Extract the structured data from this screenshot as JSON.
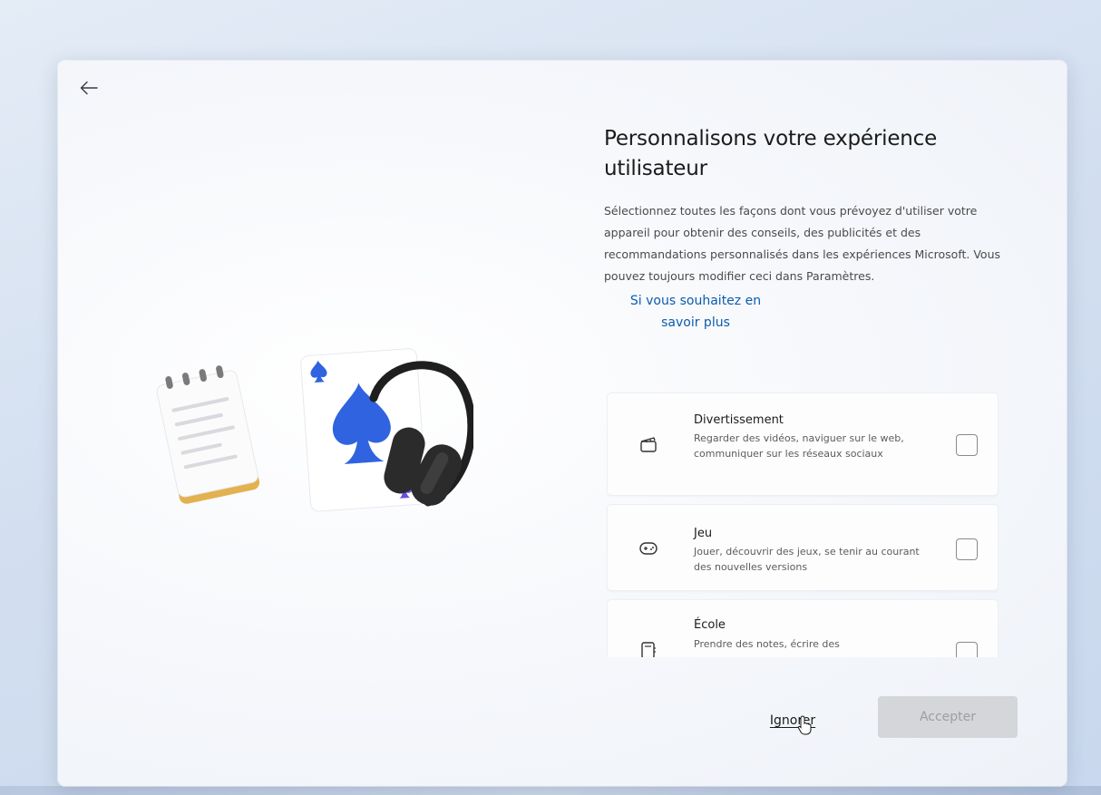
{
  "header": {
    "title": "Personnalisons votre expérience utilisateur",
    "description": "Sélectionnez toutes les façons dont vous prévoyez d'utiliser votre appareil pour obtenir des conseils, des publicités et des recommandations personnalisés dans les expériences Microsoft. Vous pouvez toujours modifier ceci dans Paramètres.",
    "learn_more": "Si vous souhaitez en savoir plus"
  },
  "options": [
    {
      "title": "Divertissement",
      "description": "Regarder des vidéos, naviguer sur le web, communiquer sur les réseaux sociaux",
      "icon": "clapperboard-icon",
      "checked": false
    },
    {
      "title": "Jeu",
      "description": "Jouer, découvrir des jeux, se tenir au courant des nouvelles versions",
      "icon": "gamepad-icon",
      "checked": false
    },
    {
      "title": "École",
      "description": "Prendre des notes, écrire des",
      "icon": "notebook-icon",
      "checked": false
    }
  ],
  "footer": {
    "skip_label": "Ignorer",
    "accept_label": "Accepter",
    "accept_enabled": false
  },
  "colors": {
    "link": "#0b5cad",
    "spade": "#2f63e0",
    "spade_small": "#6a4fe0",
    "notepad_accent": "#e8b84a"
  },
  "illustration_icons": [
    "notepad-icon",
    "playing-card-icon",
    "headphones-icon"
  ]
}
